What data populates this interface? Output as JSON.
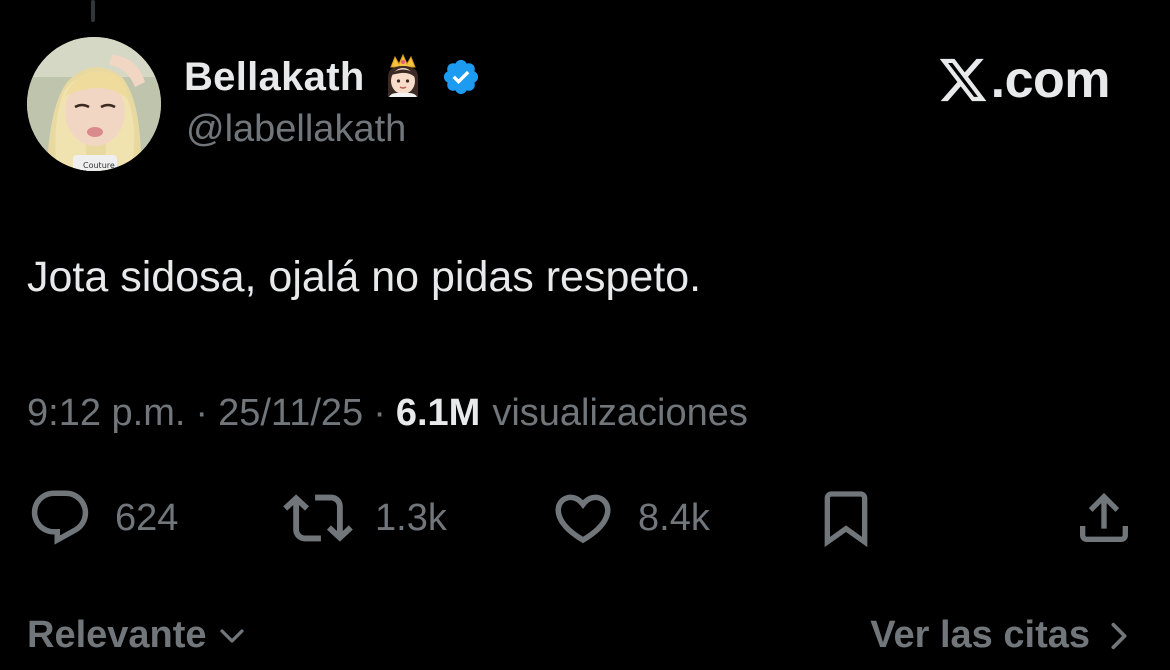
{
  "author": {
    "display_name": "Bellakath",
    "handle": "@labellakath",
    "name_emoji": "princess-with-crown-emoji",
    "verified_color": "#1d9bf0"
  },
  "brand": {
    "logo": "x-logo-icon",
    "text": ".com"
  },
  "tweet": {
    "text": "Jota sidosa, ojalá no pidas respeto.",
    "time": "9:12 p.m.",
    "separator": "·",
    "date": "25/11/25",
    "views_count": "6.1M",
    "views_label": "visualizaciones"
  },
  "actions": {
    "reply": {
      "icon": "reply-icon",
      "count": "624"
    },
    "retweet": {
      "icon": "retweet-icon",
      "count": "1.3k"
    },
    "like": {
      "icon": "heart-icon",
      "count": "8.4k"
    },
    "bookmark": {
      "icon": "bookmark-icon"
    },
    "share": {
      "icon": "share-icon"
    }
  },
  "footer": {
    "sort_label": "Relevante",
    "quotes_label": "Ver las citas"
  },
  "colors": {
    "background": "#000000",
    "primary_text": "#e7e9ea",
    "secondary_text": "#71767b",
    "verified": "#1d9bf0"
  }
}
